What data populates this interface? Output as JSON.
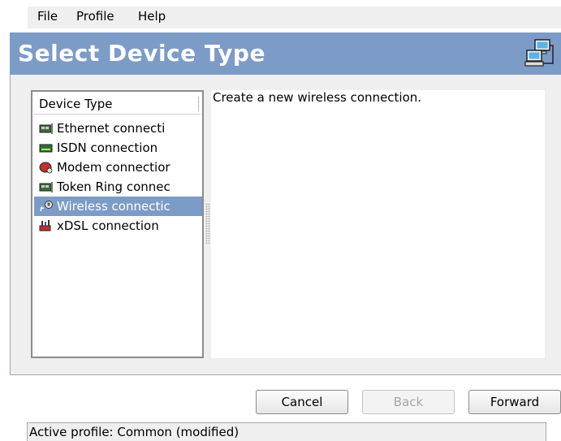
{
  "menu": [
    "File",
    "Profile",
    "Help"
  ],
  "header": {
    "title": "Select Device Type",
    "icon": "network-computers-icon"
  },
  "device_list": {
    "column_header": "Device Type",
    "items": [
      {
        "label": "Ethernet connecti",
        "icon": "ethernet-card-icon",
        "selected": false
      },
      {
        "label": "ISDN connection",
        "icon": "isdn-card-icon",
        "selected": false
      },
      {
        "label": "Modem connectior",
        "icon": "modem-icon",
        "selected": false
      },
      {
        "label": "Token Ring connec",
        "icon": "token-ring-card-icon",
        "selected": false
      },
      {
        "label": "Wireless connectic",
        "icon": "wireless-icon",
        "selected": true
      },
      {
        "label": "xDSL connection",
        "icon": "xdsl-icon",
        "selected": false
      }
    ]
  },
  "description": "Create a new wireless connection.",
  "buttons": {
    "cancel": "Cancel",
    "back": "Back",
    "forward": "Forward"
  },
  "status": "Active profile: Common (modified)",
  "colors": {
    "header_bg": "#7d9bc7",
    "selection_bg": "#7d9bc7",
    "window_bg": "#efefef"
  }
}
